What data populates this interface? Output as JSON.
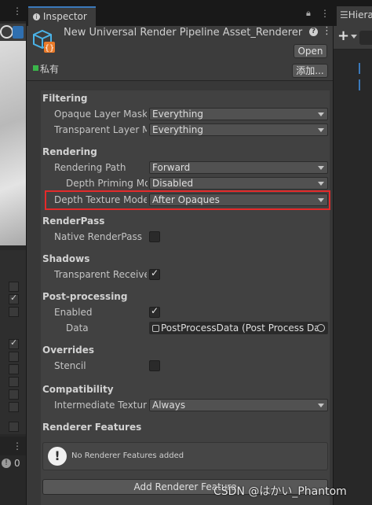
{
  "window": {
    "inspector_tab": "Inspector",
    "hierarchy_tab": "Hiera"
  },
  "header": {
    "asset_name": "New Universal Render Pipeline Asset_Renderer (",
    "open_button": "Open",
    "private_label": "私有",
    "add_label_button": "添加..."
  },
  "sections": {
    "filtering": {
      "title": "Filtering",
      "opaque_label": "Opaque Layer Mask",
      "opaque_value": "Everything",
      "transparent_label": "Transparent Layer Ma",
      "transparent_value": "Everything"
    },
    "rendering": {
      "title": "Rendering",
      "path_label": "Rendering Path",
      "path_value": "Forward",
      "priming_label": "Depth Priming Moc",
      "priming_value": "Disabled",
      "texture_label": "Depth Texture Mode",
      "texture_value": "After Opaques"
    },
    "renderpass": {
      "title": "RenderPass",
      "native_label": "Native RenderPass",
      "native_checked": false
    },
    "shadows": {
      "title": "Shadows",
      "transparent_label": "Transparent Receive",
      "transparent_checked": true
    },
    "postprocessing": {
      "title": "Post-processing",
      "enabled_label": "Enabled",
      "enabled_checked": true,
      "data_label": "Data",
      "data_value": "PostProcessData (Post Process Da"
    },
    "overrides": {
      "title": "Overrides",
      "stencil_label": "Stencil",
      "stencil_checked": false
    },
    "compatibility": {
      "title": "Compatibility",
      "intermediate_label": "Intermediate Texture",
      "intermediate_value": "Always"
    },
    "renderer_features": {
      "title": "Renderer Features",
      "notice": "No Renderer Features added",
      "add_button": "Add Renderer Feature"
    }
  },
  "left_panel": {
    "footer_count": "0"
  },
  "watermark": "CSDN @はかい_Phantom",
  "colors": {
    "highlight_border": "#e42a2a",
    "tab_accent": "#3a79bb",
    "asset_icon": "#4ab3e8",
    "asset_icon_accent": "#e87a2a"
  }
}
